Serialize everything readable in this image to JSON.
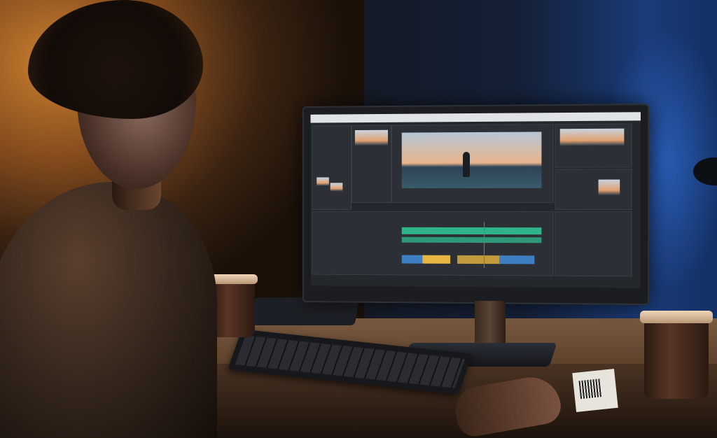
{
  "scene": {
    "description_label": "",
    "colors": {
      "warm_light": "#c9802f",
      "cool_light": "#1a3b7a",
      "editor_bg": "#24272c",
      "timeline_green": "#2fb389",
      "timeline_gold": "#e7b541",
      "timeline_blue": "#3d7fc0"
    }
  }
}
